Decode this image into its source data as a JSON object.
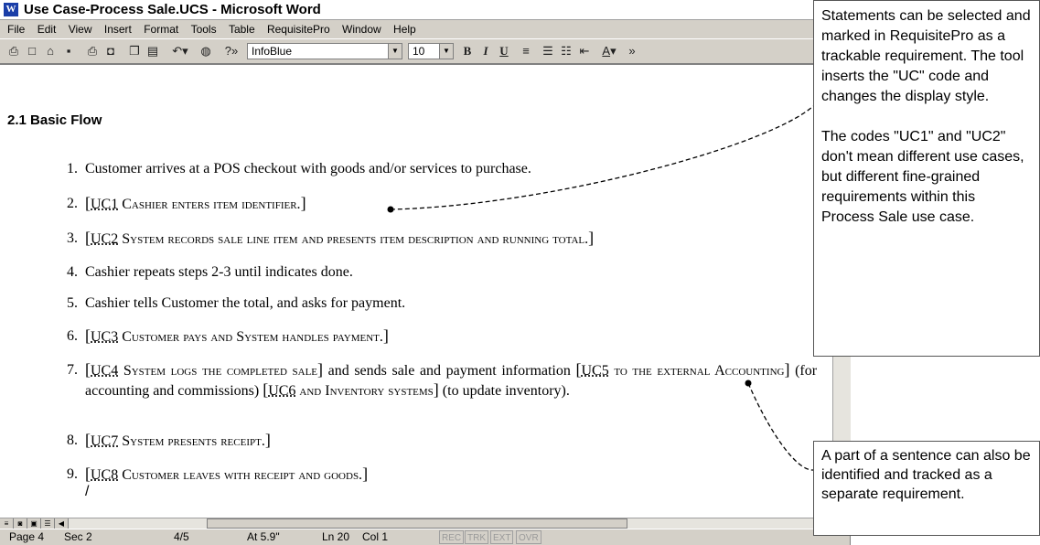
{
  "window": {
    "title": "Use Case-Process Sale.UCS - Microsoft Word",
    "app_icon": "W"
  },
  "menu": [
    "File",
    "Edit",
    "View",
    "Insert",
    "Format",
    "Tools",
    "Table",
    "RequisitePro",
    "Window",
    "Help"
  ],
  "toolbar": {
    "style_value": "InfoBlue",
    "size_value": "10",
    "bold": "B",
    "italic": "I",
    "underline": "U"
  },
  "document": {
    "heading": "2.1  Basic Flow",
    "steps": {
      "s1": {
        "num": "1.",
        "text": "Customer arrives at a POS checkout with goods and/or services to purchase."
      },
      "s2": {
        "num": "2.",
        "tag": "UC1",
        "req": "Cashier enters item identifier."
      },
      "s3": {
        "num": "3.",
        "tag": "UC2",
        "req": "System records sale line item and presents item description and running total."
      },
      "s4": {
        "num": "4.",
        "text": "Cashier repeats steps 2-3 until indicates done."
      },
      "s5": {
        "num": "5.",
        "text": "Cashier tells Customer the total, and asks for payment."
      },
      "s6": {
        "num": "6.",
        "tag": "UC3",
        "req": "Customer pays and System handles payment."
      },
      "s7": {
        "num": "7.",
        "tag_a": "UC4",
        "req_a": "System logs the completed sale",
        "text_a": " and sends sale and payment information ",
        "tag_b": "UC5",
        "req_b": "to the external Accounting",
        "text_b": " (for accounting and commissions) ",
        "tag_c": "UC6",
        "req_c": "and Inventory systems",
        "text_c": " (to update inventory)."
      },
      "s8": {
        "num": "8.",
        "tag": "UC7",
        "req": "System presents receipt."
      },
      "s9": {
        "num": "9.",
        "tag": "UC8",
        "req": "Customer leaves with receipt and goods."
      }
    }
  },
  "status": {
    "page": "Page 4",
    "sec": "Sec 2",
    "pages": "4/5",
    "at": "At 5.9\"",
    "ln": "Ln 20",
    "col": "Col 1",
    "rec": "REC",
    "trk": "TRK",
    "ext": "EXT",
    "ovr": "OVR"
  },
  "callouts": {
    "top_p1": "Statements can be selected and marked in RequisitePro as a trackable requirement. The tool inserts the \"UC\" code and changes the display style.",
    "top_p2": "The codes \"UC1\" and \"UC2\" don't mean different use cases, but different fine-grained requirements within this Process Sale use case.",
    "bottom": "A part of a sentence can also be identified and tracked as a separate requirement."
  }
}
